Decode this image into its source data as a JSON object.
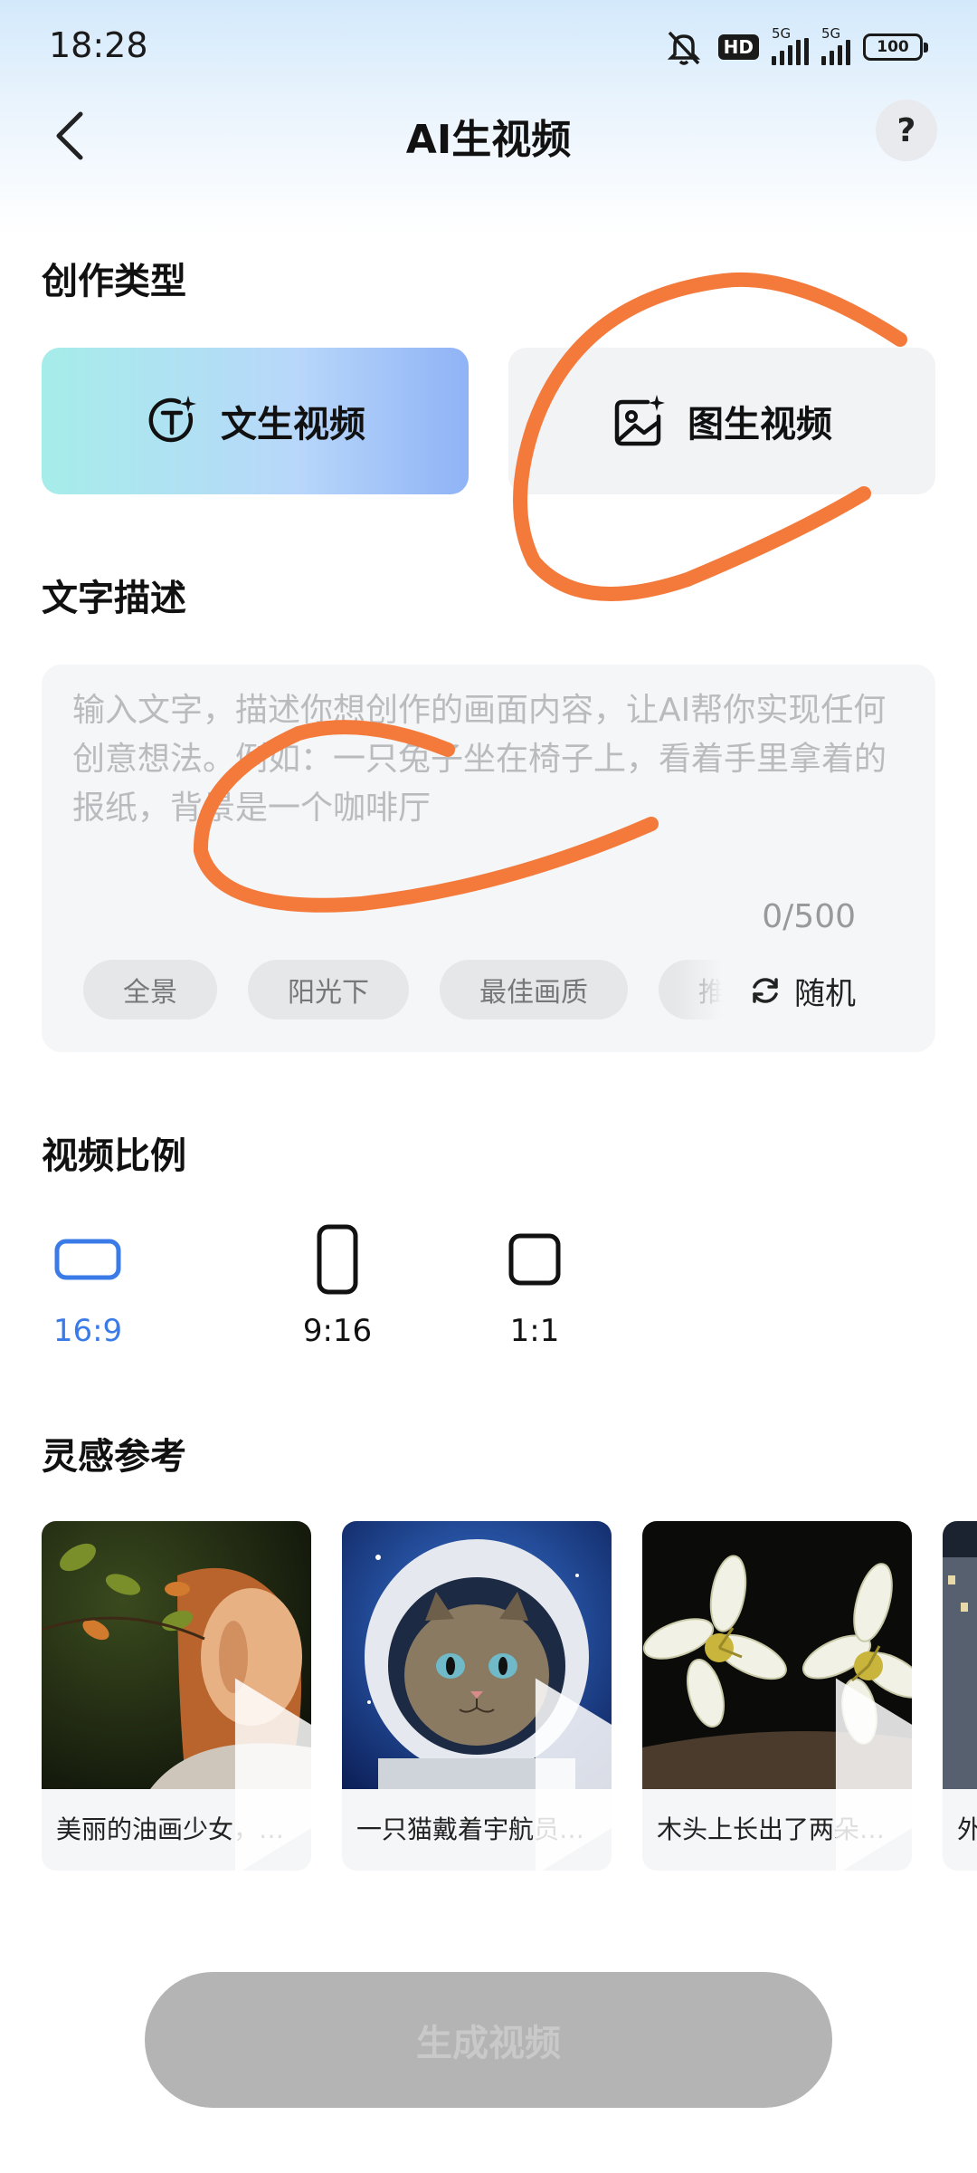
{
  "status_bar": {
    "time": "18:28",
    "hd_badge": "HD",
    "signal_1_label": "5G",
    "signal_2_label": "5G",
    "battery": "100"
  },
  "header": {
    "title": "AI生视频",
    "help_label": "?"
  },
  "creation_type": {
    "section_title": "创作类型",
    "options": [
      {
        "label": "文生视频",
        "icon": "text-t-sparkle-icon",
        "selected": true
      },
      {
        "label": "图生视频",
        "icon": "image-sparkle-icon",
        "selected": false
      }
    ]
  },
  "description": {
    "section_title": "文字描述",
    "placeholder": "输入文字，描述你想创作的画面内容，让AI帮你实现任何创意想法。例如：一只兔子坐在椅子上，看着手里拿着的报纸，背景是一个咖啡厅",
    "char_count": "0/500",
    "chips": [
      "全景",
      "阳光下",
      "最佳画质",
      "推"
    ],
    "random_label": "随机"
  },
  "ratio": {
    "section_title": "视频比例",
    "options": [
      {
        "label": "16:9",
        "selected": true
      },
      {
        "label": "9:16",
        "selected": false
      },
      {
        "label": "1:1",
        "selected": false
      }
    ]
  },
  "inspiration": {
    "section_title": "灵感参考",
    "cards": [
      {
        "caption": "美丽的油画少女，…"
      },
      {
        "caption": "一只猫戴着宇航员…"
      },
      {
        "caption": "木头上长出了两朵…"
      },
      {
        "caption": "外"
      }
    ]
  },
  "generate_label": "生成视频",
  "colors": {
    "accent": "#3b7be8",
    "active_card_from": "#a6edea",
    "active_card_to": "#8fb3f6",
    "annotation_stroke": "#f47a3c",
    "generate_disabled": "#b4b4b4"
  }
}
